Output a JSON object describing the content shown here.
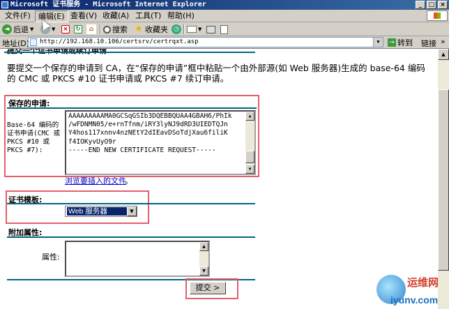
{
  "window": {
    "title": "Microsoft 证书服务 - Microsoft Internet Explorer",
    "min_glyph": "_",
    "max_glyph": "□",
    "close_glyph": "×"
  },
  "menu": {
    "items": [
      {
        "label": "文件(F)"
      },
      {
        "label": "编辑(E)"
      },
      {
        "label": "查看(V)"
      },
      {
        "label": "收藏(A)"
      },
      {
        "label": "工具(T)"
      },
      {
        "label": "帮助(H)"
      }
    ]
  },
  "toolbar": {
    "back_label": "后退",
    "search_label": "搜索",
    "favorites_label": "收藏夹",
    "dropdown_glyph": "▼"
  },
  "address": {
    "label": "地址(D)",
    "url": "http://192.168.10.106/certsrv/certrqxt.asp",
    "go_label": "转到",
    "links_label": "链接",
    "links_chevron": "»"
  },
  "page": {
    "cut_heading": "提交一个证书申请或续订申请",
    "intro": "要提交一个保存的申请到 CA，在“保存的申请”框中粘贴一个由外部源(如 Web 服务器)生成的 base-64 编码的 CMC 或 PKCS #10 证书申请或 PKCS #7 续订申请。",
    "saved_request": {
      "title": "保存的申请:",
      "label": "Base-64 编码的证书申请(CMC 或PKCS #10 或PKCS #7):",
      "lines": [
        "AAAAAAAAAMA0GCSqGSIb3DQEBBQUAA4GBAH6/PhIk",
        "/wFDNMN05/e+rnTfnm/iRY3lyNJ9dRD3UIEDTQJn",
        "Y4hos117xnnv4nzNEtY2dIEavDSoTdjXau6filiK",
        "f4IOKyvUyO9r",
        "-----END NEW CERTIFICATE REQUEST-----"
      ],
      "browse_link": "浏览要插入的文件",
      "period": "。"
    },
    "template": {
      "title": "证书模板:",
      "selected": "Web 服务器"
    },
    "attributes": {
      "title": "附加属性:",
      "label": "属性:"
    },
    "submit_label": "提交 >"
  },
  "watermark": {
    "cn": "运维网",
    "en": "iyunv.com"
  },
  "colors": {
    "accent_line": "#00667f",
    "highlight_box": "#e0606a",
    "link": "#0000cc",
    "selection": "#0a246a"
  }
}
